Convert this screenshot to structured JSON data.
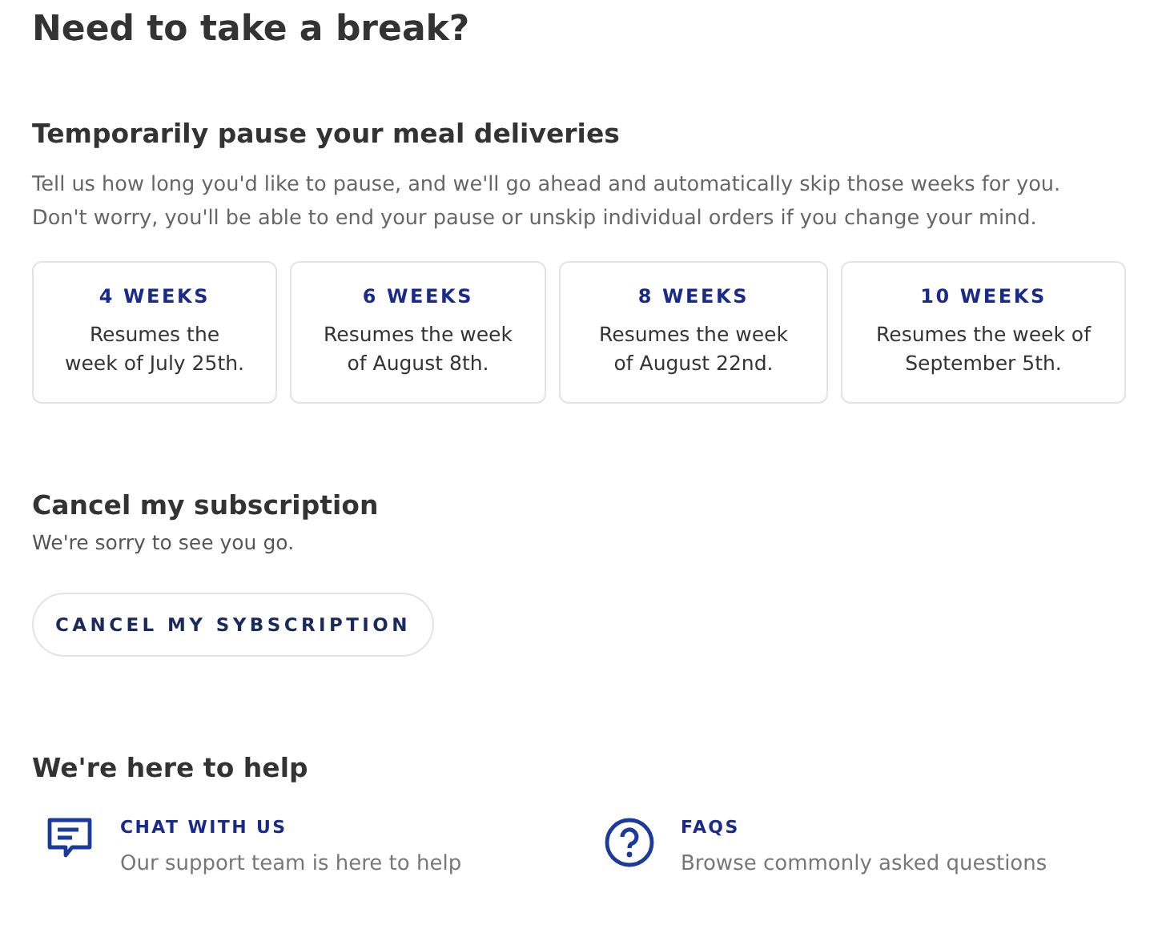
{
  "title": "Need to take a break?",
  "pause": {
    "heading": "Temporarily pause your meal deliveries",
    "description_lines": [
      "Tell us how long you'd like to pause, and we'll go ahead and automatically skip those weeks for you.",
      "Don't worry, you'll be able to end your pause or unskip individual orders if you change your mind."
    ],
    "options": [
      {
        "label": "4 WEEKS",
        "lines": [
          "Resumes the",
          "week of July 25th."
        ]
      },
      {
        "label": "6 WEEKS",
        "lines": [
          "Resumes the week",
          "of August 8th."
        ]
      },
      {
        "label": "8 WEEKS",
        "lines": [
          "Resumes the week",
          "of August 22nd."
        ]
      },
      {
        "label": "10 WEEKS",
        "lines": [
          "Resumes the week of",
          "September 5th."
        ]
      }
    ]
  },
  "cancel": {
    "heading": "Cancel my subscription",
    "subtext": "We're sorry to see you go.",
    "button": "CANCEL MY SYBSCRIPTION"
  },
  "help": {
    "heading": "We're here to help",
    "items": [
      {
        "kind": "chat",
        "title": "CHAT WITH US",
        "description": "Our support team is here to help"
      },
      {
        "kind": "faq",
        "title": "FAQS",
        "description": "Browse commonly asked questions"
      }
    ]
  }
}
